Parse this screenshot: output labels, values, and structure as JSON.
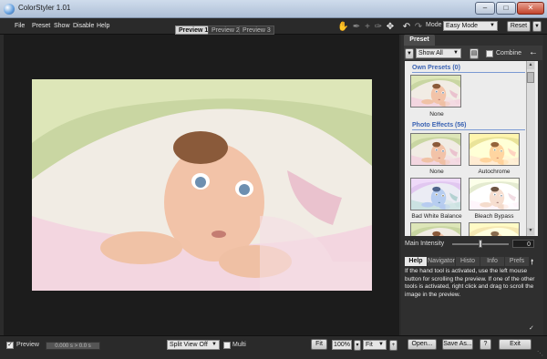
{
  "window": {
    "title": "ColorStyler 1.01"
  },
  "menu": [
    "File",
    "Preset",
    "Show",
    "Disable",
    "Help"
  ],
  "preview_tabs": [
    "Preview 1",
    "Preview 2",
    "Preview 3"
  ],
  "toolbar": {
    "mode_label": "Mode",
    "mode_value": "Easy Mode",
    "reset_label": "Reset"
  },
  "panel": {
    "tab": "Preset",
    "filter_value": "Show All",
    "combine_label": "Combine",
    "own_presets_header": "Own Presets (0)",
    "photo_effects_header": "Photo Effects (56)",
    "own_presets": [
      {
        "label": "None"
      }
    ],
    "photo_effects": [
      {
        "label": "None"
      },
      {
        "label": "Autochrome"
      },
      {
        "label": "Bad White Balance"
      },
      {
        "label": "Bleach Bypass"
      }
    ],
    "intensity_label": "Main Intensity",
    "intensity_value": "0",
    "intensity_level": 0.5
  },
  "help_tabs": [
    "Help",
    "Navigator",
    "Histo",
    "Info",
    "Prefs"
  ],
  "help_text": "If the hand tool is activated, use the left mouse button for scrolling the preview. If one of the other tools is activated, right click and drag to scroll the image in the preview.",
  "bottom": {
    "preview_label": "Preview",
    "timer": "0.000 s > 0.0 s",
    "split_view": "Split View Off",
    "multi_label": "Multi",
    "fit_label": "Fit",
    "zoom_value": "100%",
    "fit_select": "Fit",
    "open_label": "Open...",
    "save_label": "Save As...",
    "help_label": "?",
    "exit_label": "Exit"
  }
}
